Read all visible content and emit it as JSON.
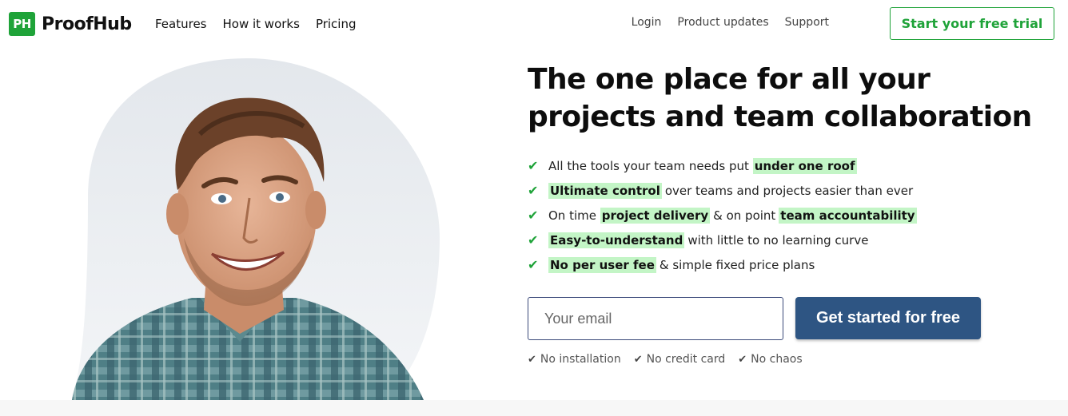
{
  "brand": {
    "mark": "PH",
    "name": "ProofHub",
    "color": "#1fa339"
  },
  "nav_left": [
    "Features",
    "How it works",
    "Pricing"
  ],
  "nav_right": [
    "Login",
    "Product updates",
    "Support"
  ],
  "trial_button": "Start your free trial",
  "headline_line1": "The one place for all your",
  "headline_line2": "projects and team collaboration",
  "features": [
    {
      "pre": "All the tools your team needs put",
      "hl": "under one roof",
      "post": ""
    },
    {
      "pre": "",
      "hl": "Ultimate control",
      "post": "over teams and projects easier than ever"
    },
    {
      "pre": "On time",
      "hl": "project delivery",
      "post": "& on point",
      "hl2": "team accountability"
    },
    {
      "pre": "",
      "hl": "Easy-to-understand",
      "post": "with little to no learning curve"
    },
    {
      "pre": "",
      "hl": "No per user fee",
      "post": "& simple fixed price plans"
    }
  ],
  "email": {
    "placeholder": "Your email",
    "value": ""
  },
  "cta_button": "Get started for free",
  "notes": [
    "No installation",
    "No credit card",
    "No chaos"
  ],
  "colors": {
    "highlight": "#c3f5c6",
    "cta": "#2e5583"
  }
}
